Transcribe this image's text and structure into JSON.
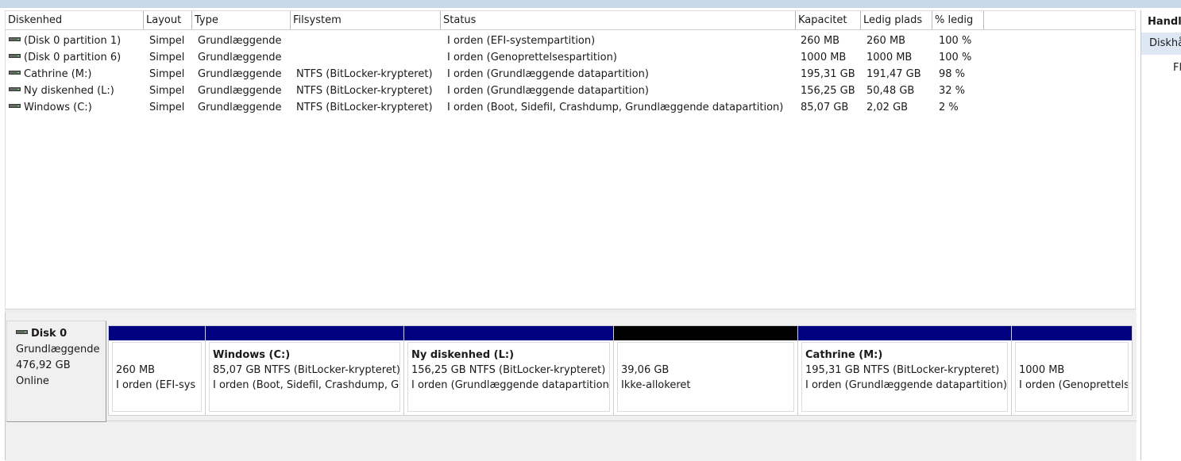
{
  "volume_list": {
    "columns": [
      "Diskenhed",
      "Layout",
      "Type",
      "Filsystem",
      "Status",
      "Kapacitet",
      "Ledig plads",
      "% ledig"
    ],
    "rows": [
      {
        "name": "(Disk 0 partition 1)",
        "layout": "Simpel",
        "type": "Grundlæggende",
        "filesystem": "",
        "status": "I orden (EFI-systempartition)",
        "capacity": "260 MB",
        "free": "260 MB",
        "pct": "100 %"
      },
      {
        "name": "(Disk 0 partition 6)",
        "layout": "Simpel",
        "type": "Grundlæggende",
        "filesystem": "",
        "status": "I orden (Genoprettelsespartition)",
        "capacity": "1000 MB",
        "free": "1000 MB",
        "pct": "100 %"
      },
      {
        "name": "Cathrine (M:)",
        "layout": "Simpel",
        "type": "Grundlæggende",
        "filesystem": "NTFS (BitLocker-krypteret)",
        "status": "I orden (Grundlæggende datapartition)",
        "capacity": "195,31 GB",
        "free": "191,47 GB",
        "pct": "98 %"
      },
      {
        "name": "Ny diskenhed (L:)",
        "layout": "Simpel",
        "type": "Grundlæggende",
        "filesystem": "NTFS (BitLocker-krypteret)",
        "status": "I orden (Grundlæggende datapartition)",
        "capacity": "156,25 GB",
        "free": "50,48 GB",
        "pct": "32 %"
      },
      {
        "name": "Windows (C:)",
        "layout": "Simpel",
        "type": "Grundlæggende",
        "filesystem": "NTFS (BitLocker-krypteret)",
        "status": "I orden (Boot, Sidefil, Crashdump, Grundlæggende datapartition)",
        "capacity": "85,07 GB",
        "free": "2,02 GB",
        "pct": "2 %"
      }
    ]
  },
  "disk": {
    "title": "Disk 0",
    "type": "Grundlæggende",
    "size": "476,92 GB",
    "state": "Online"
  },
  "partitions": [
    {
      "name": "",
      "size": "260 MB",
      "status": "I orden (EFI-sys",
      "bar": "primary"
    },
    {
      "name": "Windows  (C:)",
      "size": "85,07 GB NTFS (BitLocker-krypteret)",
      "status": "I orden (Boot, Sidefil, Crashdump, G",
      "bar": "primary"
    },
    {
      "name": "Ny diskenhed  (L:)",
      "size": "156,25 GB NTFS (BitLocker-krypteret)",
      "status": "I orden (Grundlæggende datapartition)",
      "bar": "primary"
    },
    {
      "name": "",
      "size": "39,06 GB",
      "status": "Ikke-allokeret",
      "bar": "unallocated"
    },
    {
      "name": "Cathrine  (M:)",
      "size": "195,31 GB NTFS (BitLocker-krypteret)",
      "status": "I orden (Grundlæggende datapartition)",
      "bar": "primary"
    },
    {
      "name": "",
      "size": "1000 MB",
      "status": "I orden (Genoprettelsespartition)",
      "bar": "primary"
    }
  ],
  "actions": {
    "title": "Handlinger",
    "section": "Diskhåndtering",
    "item": "Flere handlinger"
  },
  "colors": {
    "primary_partition_bar": "#000080",
    "unallocated_bar": "#000000",
    "selected_section": "#dde8f4"
  },
  "icons": [
    "disk-icon"
  ]
}
